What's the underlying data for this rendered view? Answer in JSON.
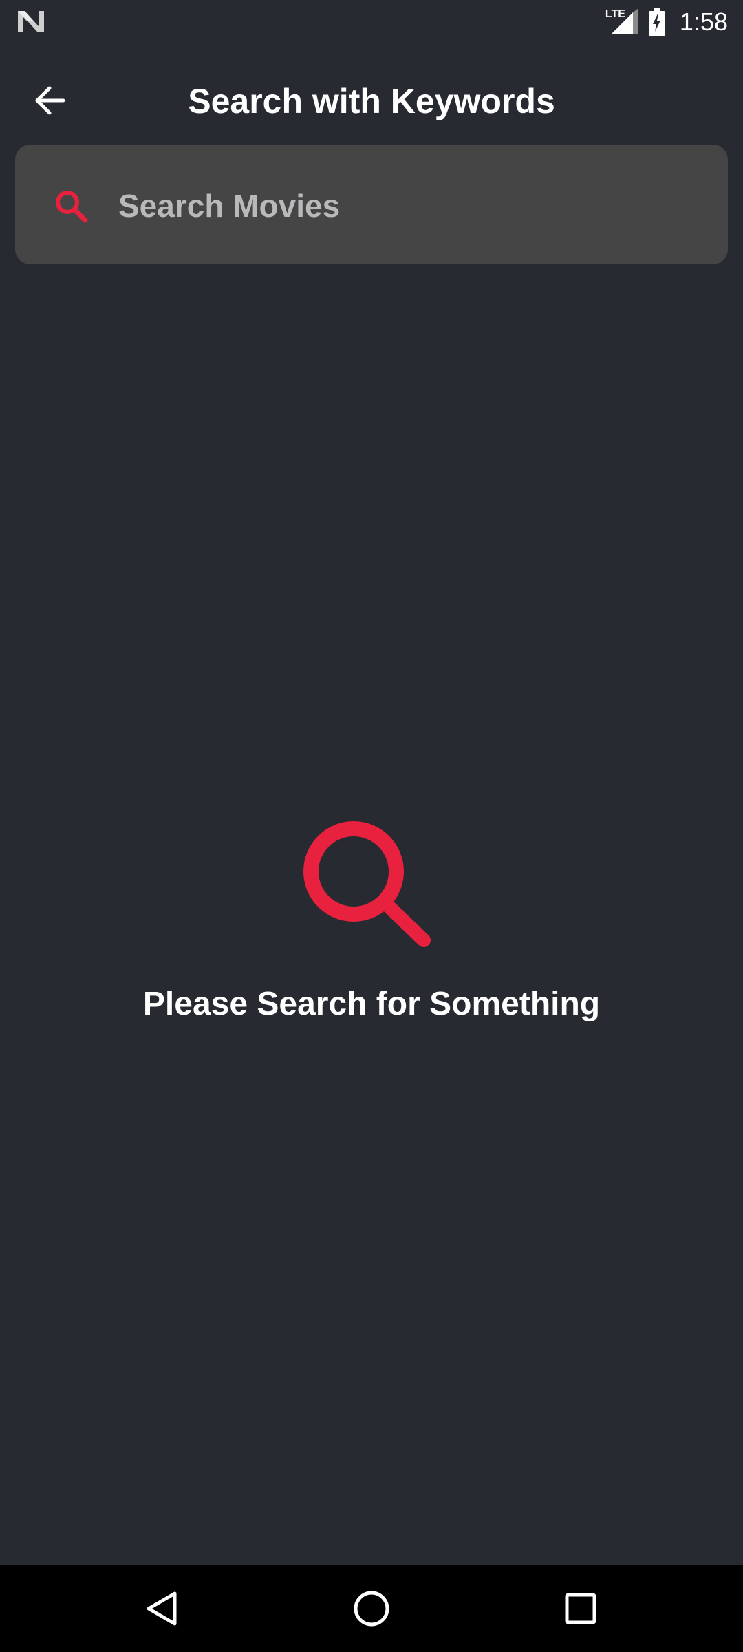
{
  "status_bar": {
    "network_label": "LTE",
    "time": "1:58",
    "left_icon": "notification-n-icon",
    "signal_icon": "cell-signal-icon",
    "battery_icon": "battery-charging-icon"
  },
  "app_bar": {
    "title": "Search with Keywords",
    "back_icon": "arrow-back-icon"
  },
  "search": {
    "placeholder": "Search Movies",
    "value": "",
    "icon": "search-icon"
  },
  "empty_state": {
    "message": "Please Search for Something",
    "icon": "search-icon"
  },
  "nav_bar": {
    "back_icon": "nav-back-triangle-icon",
    "home_icon": "nav-home-circle-icon",
    "recents_icon": "nav-recents-square-icon"
  },
  "colors": {
    "background": "#272a30",
    "search_box": "#454546",
    "accent": "#e8213f",
    "text": "#ffffff",
    "placeholder": "#b9b9bb",
    "nav_bar": "#000000"
  }
}
